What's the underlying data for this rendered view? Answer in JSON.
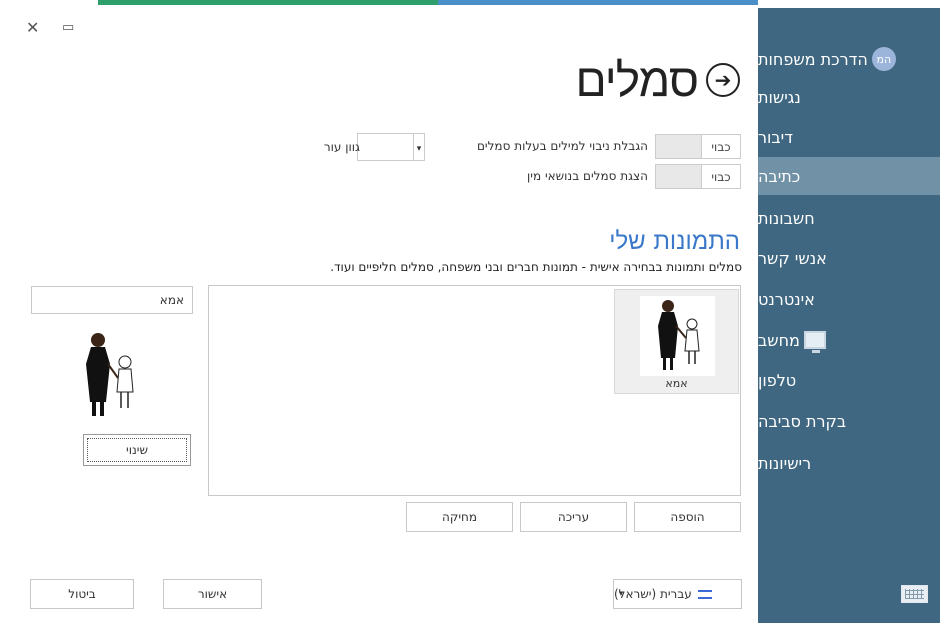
{
  "window": {
    "close_icon": "close-icon",
    "maximize_icon": "maximize-icon"
  },
  "page": {
    "title": "סמלים",
    "back_icon": "arrow-right-circle-icon"
  },
  "sidebar": {
    "items": [
      {
        "label": "הדרכת משפחות",
        "badge": "המ",
        "selected": false
      },
      {
        "label": "נגישות",
        "selected": false
      },
      {
        "label": "דיבור",
        "selected": false
      },
      {
        "label": "כתיבה",
        "selected": true
      },
      {
        "label": "חשבונות",
        "selected": false
      },
      {
        "label": "אנשי קשר",
        "selected": false
      },
      {
        "label": "אינטרנט",
        "selected": false
      },
      {
        "label": "מחשב",
        "icon": "monitor-icon",
        "selected": false
      },
      {
        "label": "טלפון",
        "selected": false
      },
      {
        "label": "בקרת סביבה",
        "selected": false
      },
      {
        "label": "רישיונות",
        "selected": false
      }
    ],
    "keyboard_icon": "keyboard-icon",
    "colors": {
      "bg": "#3f6781",
      "selected": "#7191a6"
    }
  },
  "settings": {
    "limit_prediction": {
      "label": "הגבלת ניבוי למילים בעלות סמלים",
      "state": "כבוי"
    },
    "show_gender_symbols": {
      "label": "הצגת סמלים בנושאי מין",
      "state": "כבוי"
    },
    "skin_tone": {
      "label": "גוון עור"
    }
  },
  "my_pictures": {
    "title": "התמונות שלי",
    "subtitle": "סמלים ותמונות בבחירה אישית - תמונות חברים ובני משפחה, סמלים חליפיים ועוד.",
    "items": [
      {
        "caption": "אמא"
      }
    ],
    "buttons": {
      "add": "הוספה",
      "edit": "עריכה",
      "delete": "מחיקה"
    }
  },
  "detail": {
    "name_value": "אמא",
    "change_button": "שינוי"
  },
  "footer": {
    "language": "עברית (ישראל)",
    "ok_button": "אישור",
    "cancel_button": "ביטול"
  }
}
